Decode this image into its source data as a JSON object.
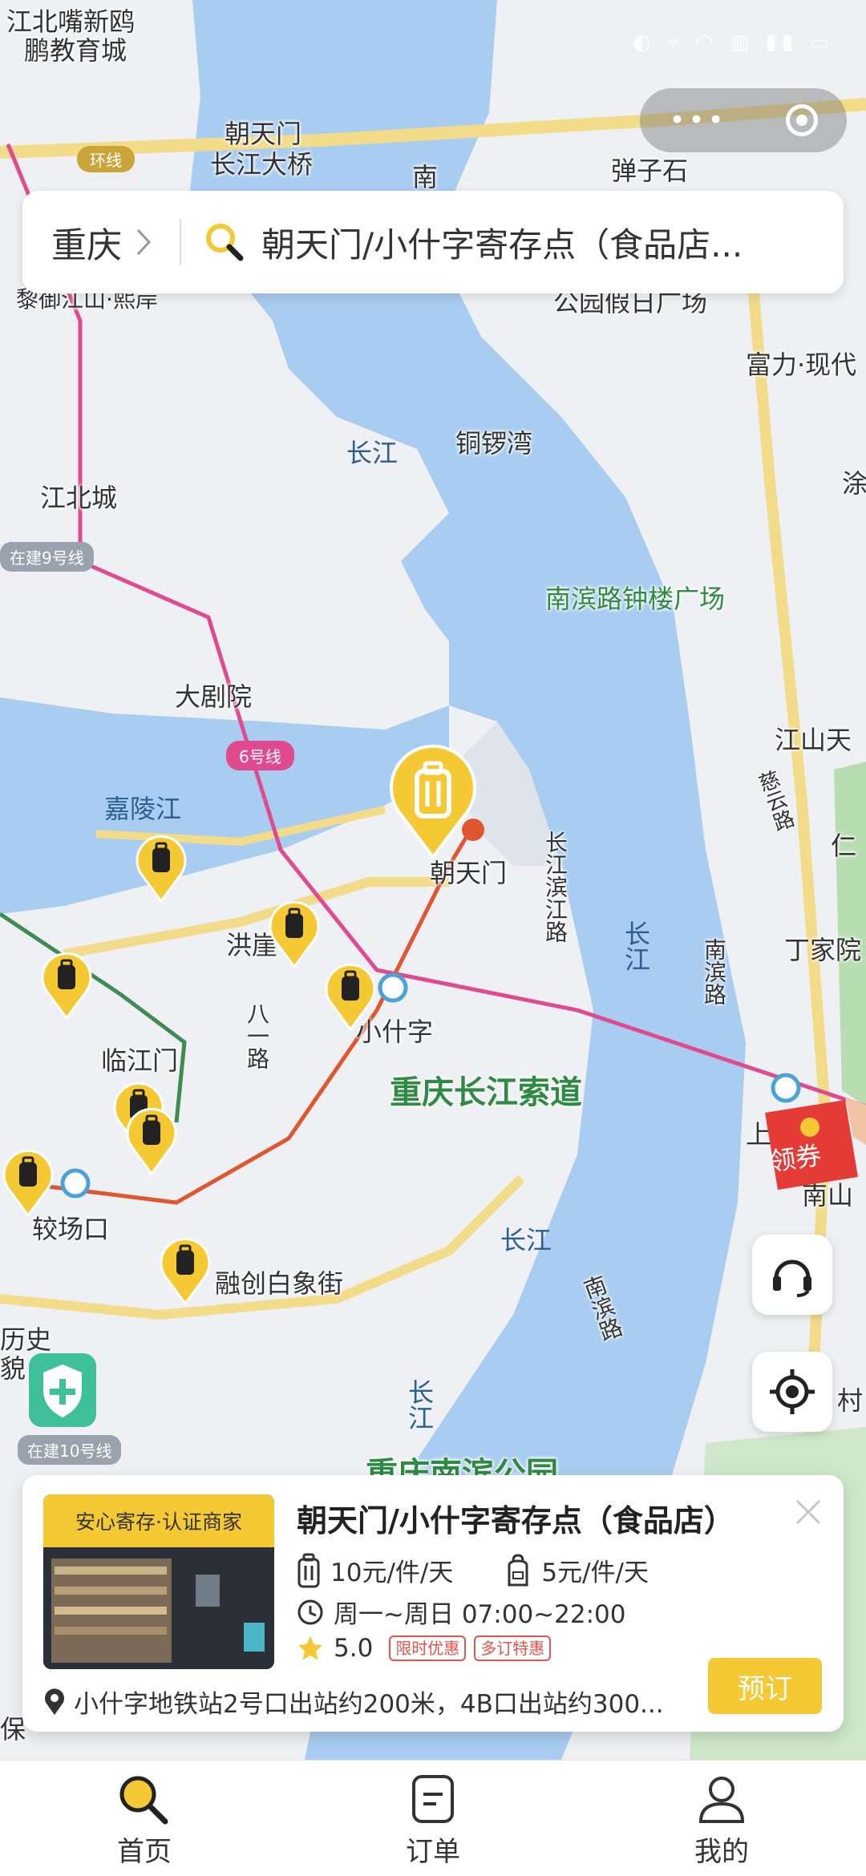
{
  "search": {
    "city": "重庆",
    "query": "朝天门/小什字寄存点（食品店..."
  },
  "map": {
    "labels": [
      {
        "text": "江北嘴新鸥",
        "style": ""
      },
      {
        "text": "鹏教育城",
        "style": ""
      },
      {
        "text": "朝天门",
        "style": ""
      },
      {
        "text": "长江大桥",
        "style": ""
      },
      {
        "text": "弹子石",
        "style": ""
      },
      {
        "text": "南",
        "style": ""
      },
      {
        "text": "黎御江山·熙岸",
        "style": ""
      },
      {
        "text": "公园假日广场",
        "style": ""
      },
      {
        "text": "富力·现代",
        "style": ""
      },
      {
        "text": "铜锣湾",
        "style": ""
      },
      {
        "text": "长江",
        "style": "water"
      },
      {
        "text": "江北城",
        "style": ""
      },
      {
        "text": "涂",
        "style": ""
      },
      {
        "text": "南滨路钟楼广场",
        "style": "green"
      },
      {
        "text": "大剧院",
        "style": ""
      },
      {
        "text": "江山天",
        "style": ""
      },
      {
        "text": "嘉陵江",
        "style": "water"
      },
      {
        "text": "慈云路",
        "style": ""
      },
      {
        "text": "仁",
        "style": ""
      },
      {
        "text": "朝天门",
        "style": ""
      },
      {
        "text": "长江滨江路",
        "style": ""
      },
      {
        "text": "长江",
        "style": "water"
      },
      {
        "text": "洪崖",
        "style": ""
      },
      {
        "text": "南滨路",
        "style": ""
      },
      {
        "text": "丁家院",
        "style": ""
      },
      {
        "text": "小什字",
        "style": ""
      },
      {
        "text": "临江门",
        "style": ""
      },
      {
        "text": "八一路",
        "style": ""
      },
      {
        "text": "重庆长江索道",
        "style": "green"
      },
      {
        "text": "上",
        "style": ""
      },
      {
        "text": "南山",
        "style": ""
      },
      {
        "text": "较场口",
        "style": ""
      },
      {
        "text": "长江",
        "style": "water"
      },
      {
        "text": "融创白象街",
        "style": ""
      },
      {
        "text": "南滨路",
        "style": ""
      },
      {
        "text": "历史",
        "style": ""
      },
      {
        "text": "貌",
        "style": ""
      },
      {
        "text": "长江",
        "style": "water"
      },
      {
        "text": "村",
        "style": ""
      },
      {
        "text": "重庆南滨公园",
        "style": "green"
      },
      {
        "text": "保",
        "style": ""
      }
    ],
    "badges": {
      "ring_road": "环线",
      "line6": "6号线",
      "line9": "在建9号线",
      "line10": "在建10号线"
    }
  },
  "coupon_label": "领券",
  "card": {
    "badge": "安心寄存·认证商家",
    "title": "朝天门/小什字寄存点（食品店）",
    "price_large": "10元/件/天",
    "price_small": "5元/件/天",
    "hours": "周一~周日 07:00~22:00",
    "rating": "5.0",
    "tags": [
      "限时优惠",
      "多订特惠"
    ],
    "address": "小什字地铁站2号口出站约200米，4B口出站约300...",
    "book_label": "预订"
  },
  "tabs": [
    {
      "label": "首页",
      "icon": "search-icon"
    },
    {
      "label": "订单",
      "icon": "order-icon"
    },
    {
      "label": "我的",
      "icon": "profile-icon"
    }
  ],
  "colors": {
    "water": "#a9cdf0",
    "land": "#eef0f3",
    "accent": "#f5c934",
    "metro_line6": "#e04b8f",
    "metro_red": "#e0562e",
    "metro_green": "#3f8c52"
  }
}
